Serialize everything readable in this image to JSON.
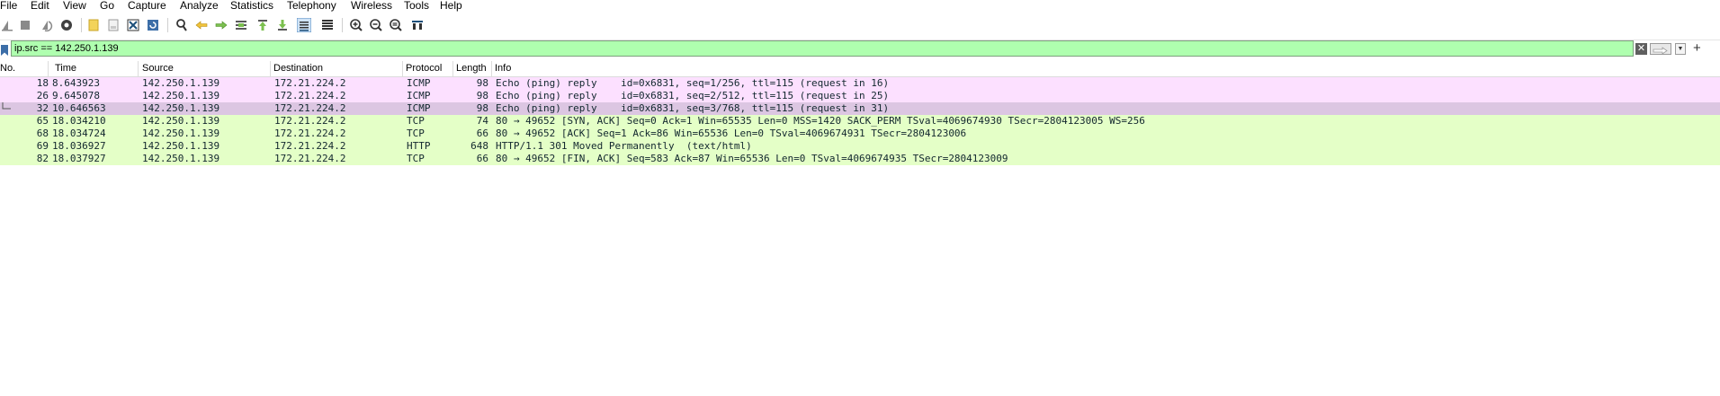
{
  "menu": [
    "File",
    "Edit",
    "View",
    "Go",
    "Capture",
    "Analyze",
    "Statistics",
    "Telephony",
    "Wireless",
    "Tools",
    "Help"
  ],
  "toolbar_icons": [
    "shark-fin-start-icon",
    "stop-capture-icon",
    "restart-capture-icon",
    "capture-options-icon",
    "open-file-icon",
    "save-file-icon",
    "close-file-icon",
    "reload-file-icon",
    "find-packet-icon",
    "go-back-icon",
    "go-forward-icon",
    "go-to-packet-icon",
    "go-to-first-icon",
    "go-to-last-icon",
    "auto-scroll-icon",
    "colorize-icon",
    "zoom-in-icon",
    "zoom-out-icon",
    "normal-size-icon",
    "resize-columns-icon"
  ],
  "filter": {
    "value": "ip.src == 142.250.1.139"
  },
  "columns": [
    "No.",
    "Time",
    "Source",
    "Destination",
    "Protocol",
    "Length",
    "Info"
  ],
  "colors": {
    "icmp_bg": "#fce0ff",
    "icmp_selected_bg": "#dcc6e2",
    "tcp_bg": "#e4ffc7",
    "filter_bg": "#afffaf"
  },
  "packets": [
    {
      "no": "18",
      "time": "8.643923",
      "src": "142.250.1.139",
      "dst": "172.21.224.2",
      "proto": "ICMP",
      "len": "98",
      "info": "Echo (ping) reply    id=0x6831, seq=1/256, ttl=115 (request in 16)",
      "kind": "icmp"
    },
    {
      "no": "26",
      "time": "9.645078",
      "src": "142.250.1.139",
      "dst": "172.21.224.2",
      "proto": "ICMP",
      "len": "98",
      "info": "Echo (ping) reply    id=0x6831, seq=2/512, ttl=115 (request in 25)",
      "kind": "icmp"
    },
    {
      "no": "32",
      "time": "10.646563",
      "src": "142.250.1.139",
      "dst": "172.21.224.2",
      "proto": "ICMP",
      "len": "98",
      "info": "Echo (ping) reply    id=0x6831, seq=3/768, ttl=115 (request in 31)",
      "kind": "icmp-selected"
    },
    {
      "no": "65",
      "time": "18.034210",
      "src": "142.250.1.139",
      "dst": "172.21.224.2",
      "proto": "TCP",
      "len": "74",
      "info": "80 → 49652 [SYN, ACK] Seq=0 Ack=1 Win=65535 Len=0 MSS=1420 SACK_PERM TSval=4069674930 TSecr=2804123005 WS=256",
      "kind": "tcp"
    },
    {
      "no": "68",
      "time": "18.034724",
      "src": "142.250.1.139",
      "dst": "172.21.224.2",
      "proto": "TCP",
      "len": "66",
      "info": "80 → 49652 [ACK] Seq=1 Ack=86 Win=65536 Len=0 TSval=4069674931 TSecr=2804123006",
      "kind": "tcp"
    },
    {
      "no": "69",
      "time": "18.036927",
      "src": "142.250.1.139",
      "dst": "172.21.224.2",
      "proto": "HTTP",
      "len": "648",
      "info": "HTTP/1.1 301 Moved Permanently  (text/html)",
      "kind": "tcp"
    },
    {
      "no": "82",
      "time": "18.037927",
      "src": "142.250.1.139",
      "dst": "172.21.224.2",
      "proto": "TCP",
      "len": "66",
      "info": "80 → 49652 [FIN, ACK] Seq=583 Ack=87 Win=65536 Len=0 TSval=4069674935 TSecr=2804123009",
      "kind": "tcp"
    }
  ]
}
